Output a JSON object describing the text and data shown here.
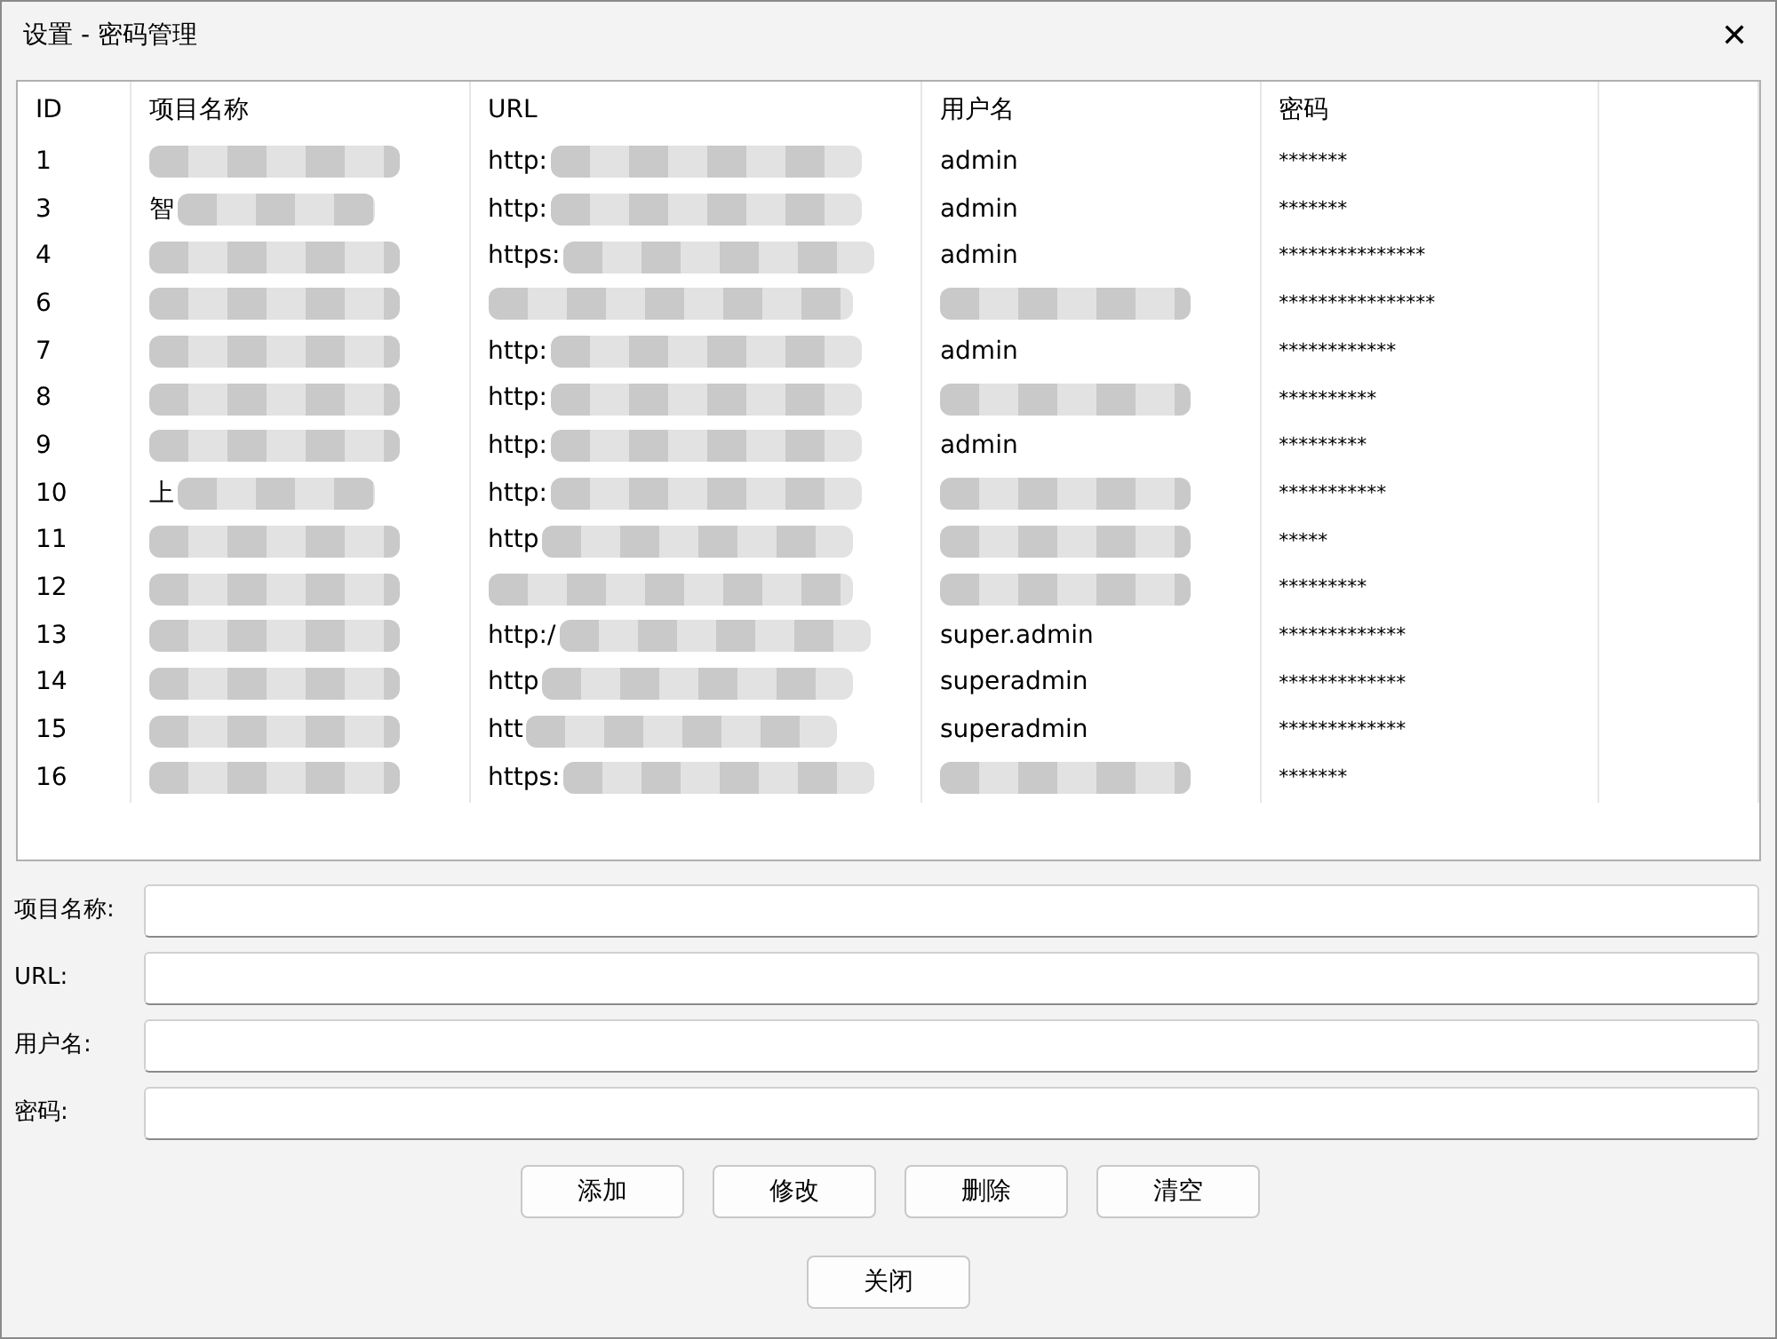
{
  "window": {
    "title": "设置 - 密码管理",
    "close": "✕"
  },
  "table": {
    "columns": [
      "ID",
      "项目名称",
      "URL",
      "用户名",
      "密码"
    ],
    "rows": [
      {
        "id": "1",
        "name": {
          "redacted": true
        },
        "url": {
          "text": "http:",
          "redacted": true
        },
        "username": {
          "text": "admin"
        },
        "password": "*******"
      },
      {
        "id": "3",
        "name": {
          "text": "智",
          "redacted": true
        },
        "url": {
          "text": "http:",
          "redacted": true
        },
        "username": {
          "text": "admin"
        },
        "password": "*******"
      },
      {
        "id": "4",
        "name": {
          "redacted": true
        },
        "url": {
          "text": "https:",
          "redacted": true
        },
        "username": {
          "text": "admin"
        },
        "password": "***************"
      },
      {
        "id": "6",
        "name": {
          "redacted": true
        },
        "url": {
          "redacted": true
        },
        "username": {
          "redacted": true
        },
        "password": "****************"
      },
      {
        "id": "7",
        "name": {
          "redacted": true
        },
        "url": {
          "text": "http:",
          "redacted": true
        },
        "username": {
          "text": "admin"
        },
        "password": "************"
      },
      {
        "id": "8",
        "name": {
          "redacted": true
        },
        "url": {
          "text": "http:",
          "redacted": true
        },
        "username": {
          "redacted": true
        },
        "password": "**********"
      },
      {
        "id": "9",
        "name": {
          "redacted": true
        },
        "url": {
          "text": "http:",
          "redacted": true
        },
        "username": {
          "text": "admin"
        },
        "password": "*********"
      },
      {
        "id": "10",
        "name": {
          "text": "上",
          "redacted": true
        },
        "url": {
          "text": "http:",
          "redacted": true
        },
        "username": {
          "redacted": true
        },
        "password": "***********"
      },
      {
        "id": "11",
        "name": {
          "redacted": true
        },
        "url": {
          "text": "http",
          "redacted": true
        },
        "username": {
          "redacted": true
        },
        "password": "*****"
      },
      {
        "id": "12",
        "name": {
          "redacted": true
        },
        "url": {
          "redacted": true
        },
        "username": {
          "redacted": true
        },
        "password": "*********"
      },
      {
        "id": "13",
        "name": {
          "redacted": true
        },
        "url": {
          "text": "http:/",
          "redacted": true
        },
        "username": {
          "text": "super.admin"
        },
        "password": "*************"
      },
      {
        "id": "14",
        "name": {
          "redacted": true
        },
        "url": {
          "text": "http",
          "redacted": true
        },
        "username": {
          "text": "superadmin"
        },
        "password": "*************"
      },
      {
        "id": "15",
        "name": {
          "redacted": true
        },
        "url": {
          "text": "htt",
          "redacted": true
        },
        "username": {
          "text": "superadmin"
        },
        "password": "*************"
      },
      {
        "id": "16",
        "name": {
          "redacted": true
        },
        "url": {
          "text": "https:",
          "redacted": true
        },
        "username": {
          "redacted": true
        },
        "password": "*******"
      }
    ]
  },
  "form": [
    {
      "label": "项目名称:"
    },
    {
      "label": "URL:"
    },
    {
      "label": "用户名:"
    },
    {
      "label": "密码:"
    }
  ],
  "buttons": [
    "添加",
    "修改",
    "删除",
    "清空"
  ],
  "close_button": "关闭"
}
